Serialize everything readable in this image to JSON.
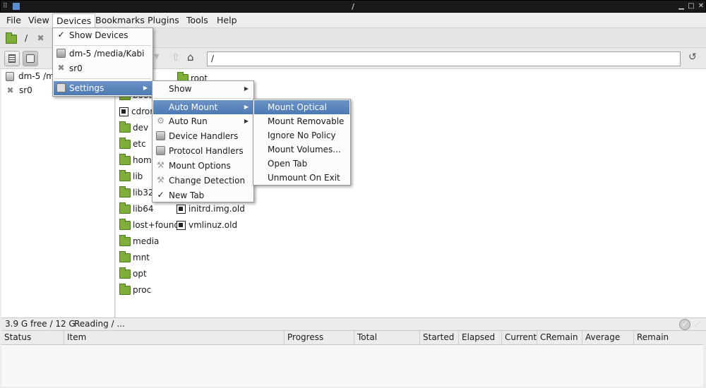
{
  "window": {
    "title": "/"
  },
  "menubar": [
    "File",
    "View",
    "Devices",
    "Bookmarks",
    "Plugins",
    "Tools",
    "Help"
  ],
  "tab": {
    "label": "/"
  },
  "path_input": {
    "value": "/"
  },
  "devices": [
    {
      "label": "dm-5 /m",
      "icon": "drive-icon"
    },
    {
      "label": "sr0",
      "icon": "optical-x-icon"
    }
  ],
  "files": {
    "col1": [
      "boot",
      "cdrom",
      "dev",
      "etc",
      "home",
      "lib",
      "lib32",
      "lib64",
      "lost+found",
      "media",
      "mnt",
      "opt",
      "proc"
    ],
    "col2_top": "root",
    "col2_bottom": [
      "initrd.img.old",
      "vmlinuz.old"
    ]
  },
  "devices_menu": {
    "show_devices": "Show Devices",
    "items": [
      "dm-5 /media/Kabi",
      "sr0"
    ],
    "settings": "Settings"
  },
  "settings_menu": [
    "Show",
    "Auto Mount",
    "Auto Run",
    "Device Handlers",
    "Protocol Handlers",
    "Mount Options",
    "Change Detection",
    "New Tab"
  ],
  "automount_menu": [
    "Mount Optical",
    "Mount Removable",
    "Ignore No Policy",
    "Mount Volumes...",
    "Open Tab",
    "Unmount On Exit"
  ],
  "status": {
    "free": "3.9 G free / 12 G",
    "reading": "Reading / ..."
  },
  "task_columns": [
    "Status",
    "Item",
    "Progress",
    "Total",
    "Started",
    "Elapsed",
    "Current",
    "CRemain",
    "Average",
    "Remain"
  ],
  "colors": {
    "folder": "#7fae3b",
    "menu_highlight": "#5a83bb",
    "titlebar": "#191919"
  }
}
